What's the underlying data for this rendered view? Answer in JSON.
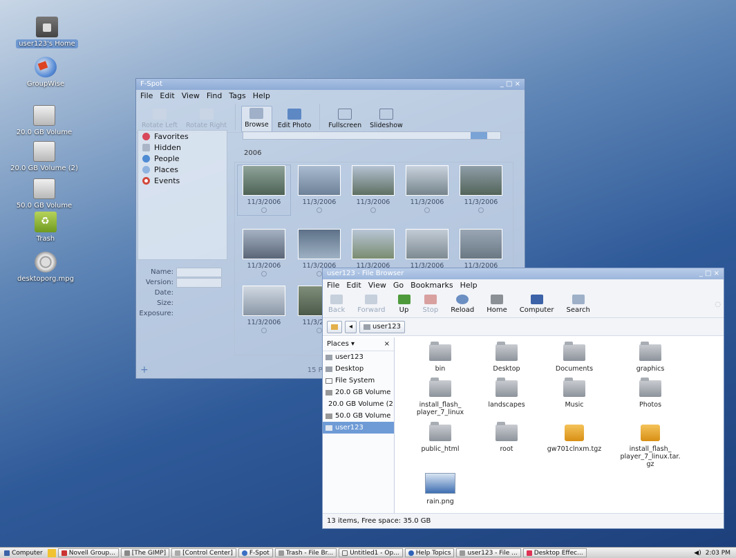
{
  "desktop": {
    "icons": [
      {
        "label": "user123's Home",
        "icon": "home-folder-icon"
      },
      {
        "label": "GroupWise",
        "icon": "groupwise-icon"
      },
      {
        "label": "20.0 GB Volume",
        "icon": "drive-icon"
      },
      {
        "label": "20.0 GB Volume (2)",
        "icon": "drive-icon"
      },
      {
        "label": "50.0 GB Volume",
        "icon": "drive-icon"
      },
      {
        "label": "Trash",
        "icon": "trash-icon"
      },
      {
        "label": "desktoporg.mpg",
        "icon": "video-file-icon"
      }
    ]
  },
  "fspot": {
    "title": "F-Spot",
    "menu": [
      "File",
      "Edit",
      "View",
      "Find",
      "Tags",
      "Help"
    ],
    "toolbar": {
      "rotate_left": "Rotate Left",
      "rotate_right": "Rotate Right",
      "browse": "Browse",
      "edit_photo": "Edit Photo",
      "fullscreen": "Fullscreen",
      "slideshow": "Slideshow"
    },
    "tags": [
      {
        "label": "Favorites",
        "color": "#d8475b"
      },
      {
        "label": "Hidden",
        "color": "#aab6c8"
      },
      {
        "label": "People",
        "color": "#4f8bd3"
      },
      {
        "label": "Places",
        "color": "#8fb3de"
      },
      {
        "label": "Events",
        "color": "#d24a3b"
      }
    ],
    "info": {
      "name": "Name:",
      "version": "Version:",
      "date": "Date:",
      "size": "Size:",
      "exposure": "Exposure:"
    },
    "timeline_year": "2006",
    "photo_date": "11/3/2006",
    "status": "15 Photos"
  },
  "filebrowser": {
    "title": "user123 - File Browser",
    "menu": [
      "File",
      "Edit",
      "View",
      "Go",
      "Bookmarks",
      "Help"
    ],
    "toolbar": {
      "back": "Back",
      "forward": "Forward",
      "up": "Up",
      "stop": "Stop",
      "reload": "Reload",
      "home": "Home",
      "computer": "Computer",
      "search": "Search"
    },
    "location": "user123",
    "places_label": "Places",
    "places": [
      {
        "label": "user123"
      },
      {
        "label": "Desktop"
      },
      {
        "label": "File System"
      },
      {
        "label": "20.0 GB Volume"
      },
      {
        "label": "20.0 GB Volume (2"
      },
      {
        "label": "50.0 GB Volume"
      },
      {
        "label": "user123",
        "selected": true
      }
    ],
    "files": [
      {
        "name": "bin",
        "type": "folder"
      },
      {
        "name": "Desktop",
        "type": "folder"
      },
      {
        "name": "Documents",
        "type": "folder"
      },
      {
        "name": "graphics",
        "type": "folder"
      },
      {
        "name": "install_flash_\nplayer_7_linux",
        "type": "folder"
      },
      {
        "name": "landscapes",
        "type": "folder"
      },
      {
        "name": "Music",
        "type": "folder"
      },
      {
        "name": "Photos",
        "type": "folder"
      },
      {
        "name": "public_html",
        "type": "folder"
      },
      {
        "name": "root",
        "type": "folder"
      },
      {
        "name": "gw701clnxm.tgz",
        "type": "package"
      },
      {
        "name": "install_flash_\nplayer_7_linux.tar.\ngz",
        "type": "package"
      },
      {
        "name": "rain.png",
        "type": "image"
      }
    ],
    "status": "13 items, Free space: 35.0 GB"
  },
  "taskbar": {
    "start": "Computer",
    "tasks": [
      "Novell Group...",
      "[The GIMP]",
      "[Control Center]",
      "F-Spot",
      "Trash - File Br...",
      "Untitled1 - Op...",
      "Help Topics",
      "user123 - File ...",
      "Desktop Effec..."
    ],
    "clock": "2:03 PM"
  }
}
